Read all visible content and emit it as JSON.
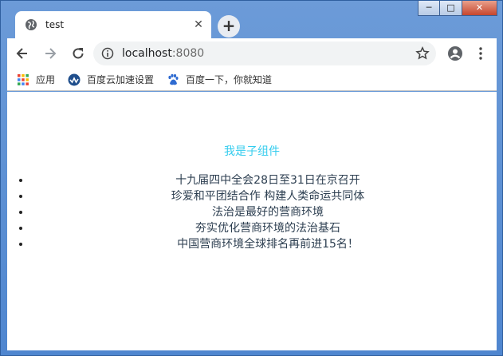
{
  "browser": {
    "tab": {
      "title": "test"
    },
    "newtab_label": "+",
    "address": {
      "host": "localhost",
      "port": ":8080"
    },
    "bookmarks": [
      {
        "label": "应用",
        "icon": "apps-grid-icon"
      },
      {
        "label": "百度云加速设置",
        "icon": "baidu-cloud-icon"
      },
      {
        "label": "百度一下，你就知道",
        "icon": "baidu-paw-icon"
      }
    ],
    "colors": {
      "frame": "#4f86cf",
      "accent": "#33ccee",
      "text": "#2c3e50"
    }
  },
  "page": {
    "child_title": "我是子组件",
    "news": [
      "十九届四中全会28日至31日在京召开",
      "珍爱和平团结合作 构建人类命运共同体",
      "法治是最好的营商环境",
      "夯实优化营商环境的法治基石",
      "中国营商环境全球排名再前进15名！"
    ]
  }
}
